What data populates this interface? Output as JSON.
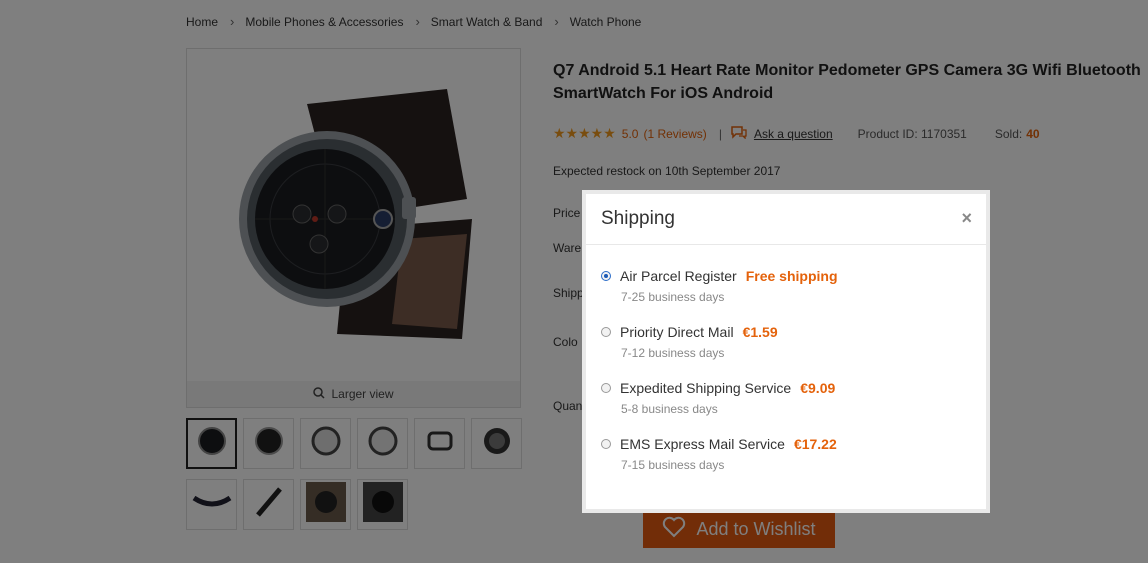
{
  "breadcrumb": [
    "Home",
    "Mobile Phones & Accessories",
    "Smart Watch & Band",
    "Watch Phone"
  ],
  "product": {
    "image_larger_view": "Larger view",
    "title": "Q7 Android 5.1 Heart Rate Monitor Pedometer GPS Camera 3G Wifi Bluetooth SmartWatch For iOS Android",
    "rating": "5.0",
    "reviews": "(1 Reviews)",
    "divider": "|",
    "ask_question": "Ask a question",
    "product_id_label": "Product ID: 1170351",
    "sold_label": "Sold:",
    "sold_count": "40",
    "restock": "Expected restock on 10th September 2017",
    "labels": {
      "price": "Price",
      "warehouse": "Ware",
      "shipping": "Shipp",
      "color": "Colo",
      "quantity": "Quan"
    },
    "wishlist_label": "Add to Wishlist",
    "thumbnail_count": 10
  },
  "modal": {
    "title": "Shipping",
    "close": "×",
    "options": [
      {
        "name": "Air Parcel Register",
        "price": "Free shipping",
        "days": "7-25 business days",
        "selected": true
      },
      {
        "name": "Priority Direct Mail",
        "price": "€1.59",
        "days": "7-12 business days",
        "selected": false
      },
      {
        "name": "Expedited Shipping Service",
        "price": "€9.09",
        "days": "5-8 business days",
        "selected": false
      },
      {
        "name": "EMS Express Mail Service",
        "price": "€17.22",
        "days": "7-15 business days",
        "selected": false
      }
    ]
  },
  "colors": {
    "accent": "#e4620b",
    "radio_selected": "#1d5bb5",
    "overlay": "rgba(0,0,0,0.5)"
  }
}
